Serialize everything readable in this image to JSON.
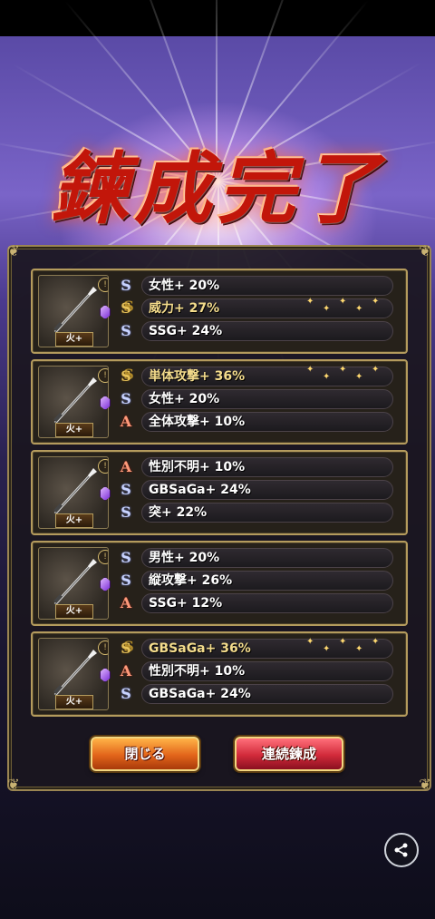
{
  "screen": {
    "title": "鍊成完了"
  },
  "cards": [
    {
      "element": "火+",
      "stats": [
        {
          "rank": "S",
          "text": "女性+ 20%"
        },
        {
          "rank": "SS",
          "text": "威力+ 27%"
        },
        {
          "rank": "S",
          "text": "SSG+ 24%"
        }
      ]
    },
    {
      "element": "火+",
      "stats": [
        {
          "rank": "SS",
          "text": "単体攻撃+ 36%"
        },
        {
          "rank": "S",
          "text": "女性+ 20%"
        },
        {
          "rank": "A",
          "text": "全体攻撃+ 10%"
        }
      ]
    },
    {
      "element": "火+",
      "stats": [
        {
          "rank": "A",
          "text": "性別不明+ 10%"
        },
        {
          "rank": "S",
          "text": "GBSaGa+ 24%"
        },
        {
          "rank": "S",
          "text": "突+ 22%"
        }
      ]
    },
    {
      "element": "火+",
      "stats": [
        {
          "rank": "S",
          "text": "男性+ 20%"
        },
        {
          "rank": "S",
          "text": "縦攻撃+ 26%"
        },
        {
          "rank": "A",
          "text": "SSG+ 12%"
        }
      ]
    },
    {
      "element": "火+",
      "stats": [
        {
          "rank": "SS",
          "text": "GBSaGa+ 36%"
        },
        {
          "rank": "A",
          "text": "性別不明+ 10%"
        },
        {
          "rank": "S",
          "text": "GBSaGa+ 24%"
        }
      ]
    }
  ],
  "buttons": {
    "close_label": "閉じる",
    "continue_label": "連続鍊成"
  },
  "icons": {
    "share": "share-icon",
    "lock": "lock-icon",
    "gem": "gem-icon",
    "weapon": "spear-icon"
  },
  "colors": {
    "panel_border": "#b49b5d",
    "close_button": "#e2641a",
    "continue_button": "#d12a3a",
    "title_red": "#c2160a"
  }
}
